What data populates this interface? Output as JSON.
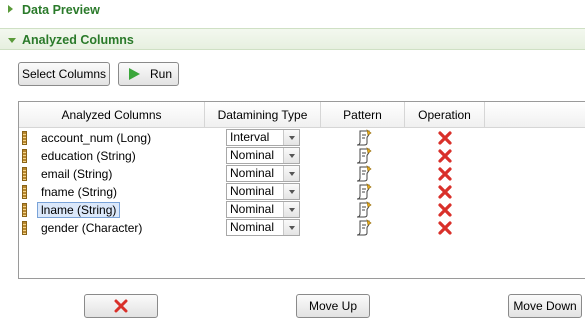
{
  "sections": {
    "data_preview": "Data Preview",
    "analyzed_columns": "Analyzed Columns"
  },
  "toolbar": {
    "select_columns": "Select Columns",
    "run": "Run"
  },
  "table": {
    "headers": [
      "Analyzed Columns",
      "Datamining Type",
      "Pattern",
      "Operation"
    ],
    "rows": [
      {
        "name": "account_num (Long)",
        "type": "Interval",
        "selected": false
      },
      {
        "name": "education (String)",
        "type": "Nominal",
        "selected": false
      },
      {
        "name": "email (String)",
        "type": "Nominal",
        "selected": false
      },
      {
        "name": "fname (String)",
        "type": "Nominal",
        "selected": false
      },
      {
        "name": "lname (String)",
        "type": "Nominal",
        "selected": true
      },
      {
        "name": "gender (Character)",
        "type": "Nominal",
        "selected": false
      }
    ]
  },
  "bottom": {
    "move_up": "Move Up",
    "move_down": "Move Down"
  },
  "colors": {
    "section_header_text": "#2a7a2a",
    "delete_icon": "#d9302a",
    "run_icon": "#3aa63a"
  },
  "icons": {
    "column": "column-icon",
    "pattern": "pattern-icon",
    "delete": "delete-icon",
    "run": "play-icon"
  }
}
